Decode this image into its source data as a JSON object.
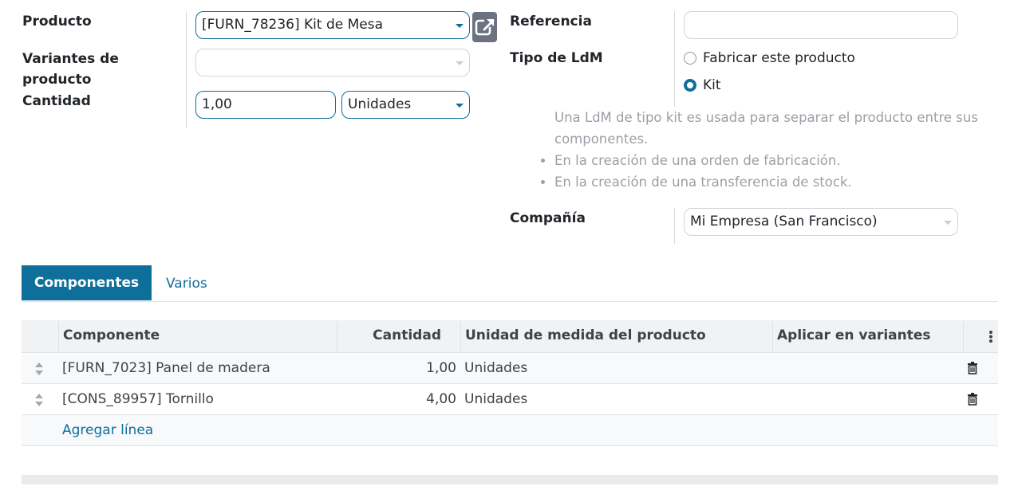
{
  "left": {
    "product_label": "Producto",
    "product_value": "[FURN_78236] Kit de Mesa",
    "variants_label_1": "Variantes de",
    "variants_label_2": "producto",
    "variants_value": "",
    "quantity_label": "Cantidad",
    "quantity_value": "1,00",
    "uom_value": "Unidades"
  },
  "right": {
    "reference_label": "Referencia",
    "reference_value": "",
    "bom_type_label": "Tipo de LdM",
    "bom_type_options": [
      "Fabricar este producto",
      "Kit"
    ],
    "bom_type_selected": "Kit",
    "help_intro": "Una LdM de tipo kit es usada para separar el producto entre sus componentes.",
    "help_bullets": [
      "En la creación de una orden de fabricación.",
      "En la creación de una transferencia de stock."
    ],
    "company_label": "Compañía",
    "company_value": "Mi Empresa (San Francisco)"
  },
  "tabs": [
    {
      "label": "Componentes",
      "active": true
    },
    {
      "label": "Varios",
      "active": false
    }
  ],
  "table": {
    "columns": [
      "Componente",
      "Cantidad",
      "Unidad de medida del producto",
      "Aplicar en variantes"
    ],
    "rows": [
      {
        "component": "[FURN_7023] Panel de madera",
        "quantity": "1,00",
        "uom": "Unidades",
        "variants": ""
      },
      {
        "component": "[CONS_89957] Tornillo",
        "quantity": "4,00",
        "uom": "Unidades",
        "variants": ""
      }
    ],
    "add_line": "Agregar línea"
  },
  "colors": {
    "primary": "#0f6f9b",
    "muted_text": "#9aa0a6",
    "header_bg": "#f1f2f3"
  }
}
